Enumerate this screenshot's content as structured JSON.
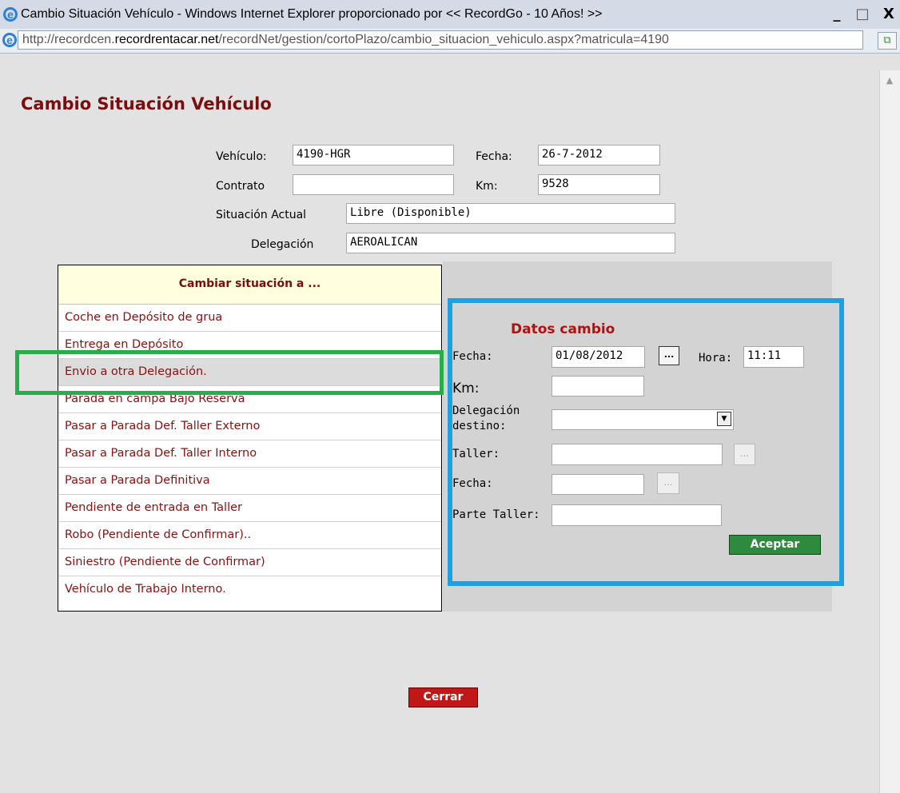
{
  "window": {
    "title": "Cambio Situación Vehículo - Windows Internet Explorer proporcionado por << RecordGo - 10 Años! >>",
    "minimize": "_",
    "maximize": "□",
    "close": "X"
  },
  "address": {
    "prefix": "http://recordcen.",
    "domain": "recordrentacar.net",
    "path": "/recordNet/gestion/cortoPlazo/cambio_situacion_vehiculo.aspx?matricula=4190"
  },
  "page": {
    "title": "Cambio Situación Vehículo"
  },
  "vehicle": {
    "vehiculo_label": "Vehículo:",
    "vehiculo_value": "4190-HGR",
    "fecha_label": "Fecha:",
    "fecha_value": "26-7-2012",
    "contrato_label": "Contrato",
    "contrato_value": "",
    "km_label": "Km:",
    "km_value": "9528",
    "situacion_label": "Situación Actual",
    "situacion_value": "Libre (Disponible)",
    "delegacion_label": "Delegación",
    "delegacion_value": "AEROALICAN"
  },
  "menu": {
    "header": "Cambiar situación a ...",
    "items": [
      "Coche en Depósito de grua",
      "Entrega en Depósito",
      "Envio a otra Delegación.",
      "Parada en campa Bajo Reserva",
      "Pasar a Parada Def. Taller Externo",
      "Pasar a Parada Def. Taller Interno",
      "Pasar a Parada Definitiva",
      "Pendiente de entrada en Taller",
      "Robo (Pendiente de Confirmar)..",
      "Siniestro (Pendiente de Confirmar)",
      "Vehículo de Trabajo Interno."
    ],
    "selected_index": 2
  },
  "datos": {
    "title": "Datos cambio",
    "fecha_label": "Fecha:",
    "fecha_value": "01/08/2012",
    "picker": "...",
    "hora_label": "Hora:",
    "hora_value": "11:11",
    "km_label": "Km:",
    "km_value": "",
    "delegacion_label_1": "Delegación",
    "delegacion_label_2": "destino:",
    "delegacion_value": "",
    "taller_label": "Taller:",
    "taller_value": "",
    "fecha2_label": "Fecha:",
    "fecha2_value": "",
    "parte_label": "Parte Taller:",
    "parte_value": "",
    "aceptar": "Aceptar"
  },
  "footer": {
    "cerrar": "Cerrar"
  },
  "colors": {
    "title_red": "#7a0e0e",
    "green_highlight": "#27ae4a",
    "blue_highlight": "#1fa0e2",
    "accept_green": "#2e8b3e",
    "close_red": "#c01818"
  }
}
